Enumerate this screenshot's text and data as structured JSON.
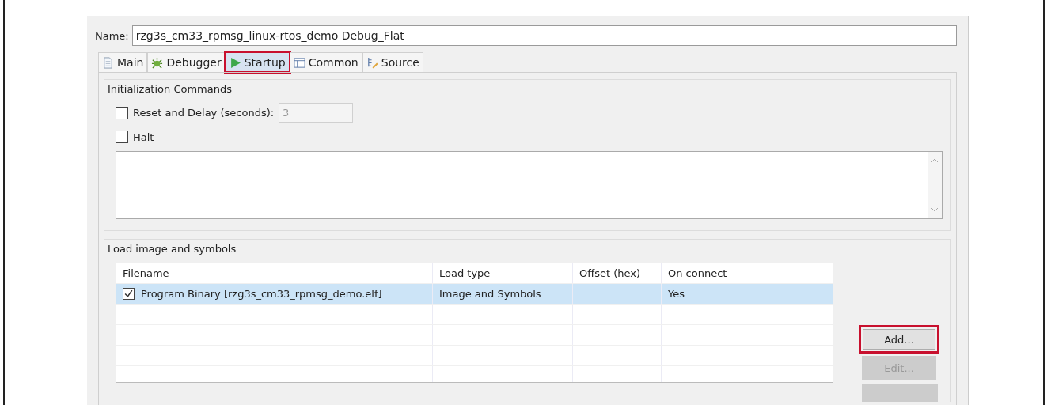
{
  "name_field": {
    "label": "Name:",
    "value": "rzg3s_cm33_rpmsg_linux-rtos_demo Debug_Flat"
  },
  "tabs": [
    {
      "label": "Main",
      "kind": "page",
      "selected": false,
      "highlighted": false
    },
    {
      "label": "Debugger",
      "kind": "bug",
      "selected": false,
      "highlighted": false
    },
    {
      "label": "Startup",
      "kind": "play",
      "selected": true,
      "highlighted": true
    },
    {
      "label": "Common",
      "kind": "table",
      "selected": false,
      "highlighted": false
    },
    {
      "label": "Source",
      "kind": "source",
      "selected": false,
      "highlighted": false
    }
  ],
  "init_group": {
    "title": "Initialization Commands",
    "options": [
      {
        "label": "Reset and Delay (seconds):",
        "checked": false,
        "value": "3"
      },
      {
        "label": "Halt",
        "checked": false
      }
    ]
  },
  "load_group": {
    "title": "Load image and symbols",
    "columns": [
      "Filename",
      "Load type",
      "Offset (hex)",
      "On connect"
    ],
    "rows": [
      {
        "checked": true,
        "selected": true,
        "cells": [
          "Program Binary [rzg3s_cm33_rpmsg_demo.elf]",
          "Image and Symbols",
          "",
          "Yes"
        ]
      }
    ],
    "buttons": [
      {
        "label": "Add...",
        "disabled": false,
        "highlighted": true
      },
      {
        "label": "Edit...",
        "disabled": true,
        "highlighted": false
      }
    ]
  }
}
